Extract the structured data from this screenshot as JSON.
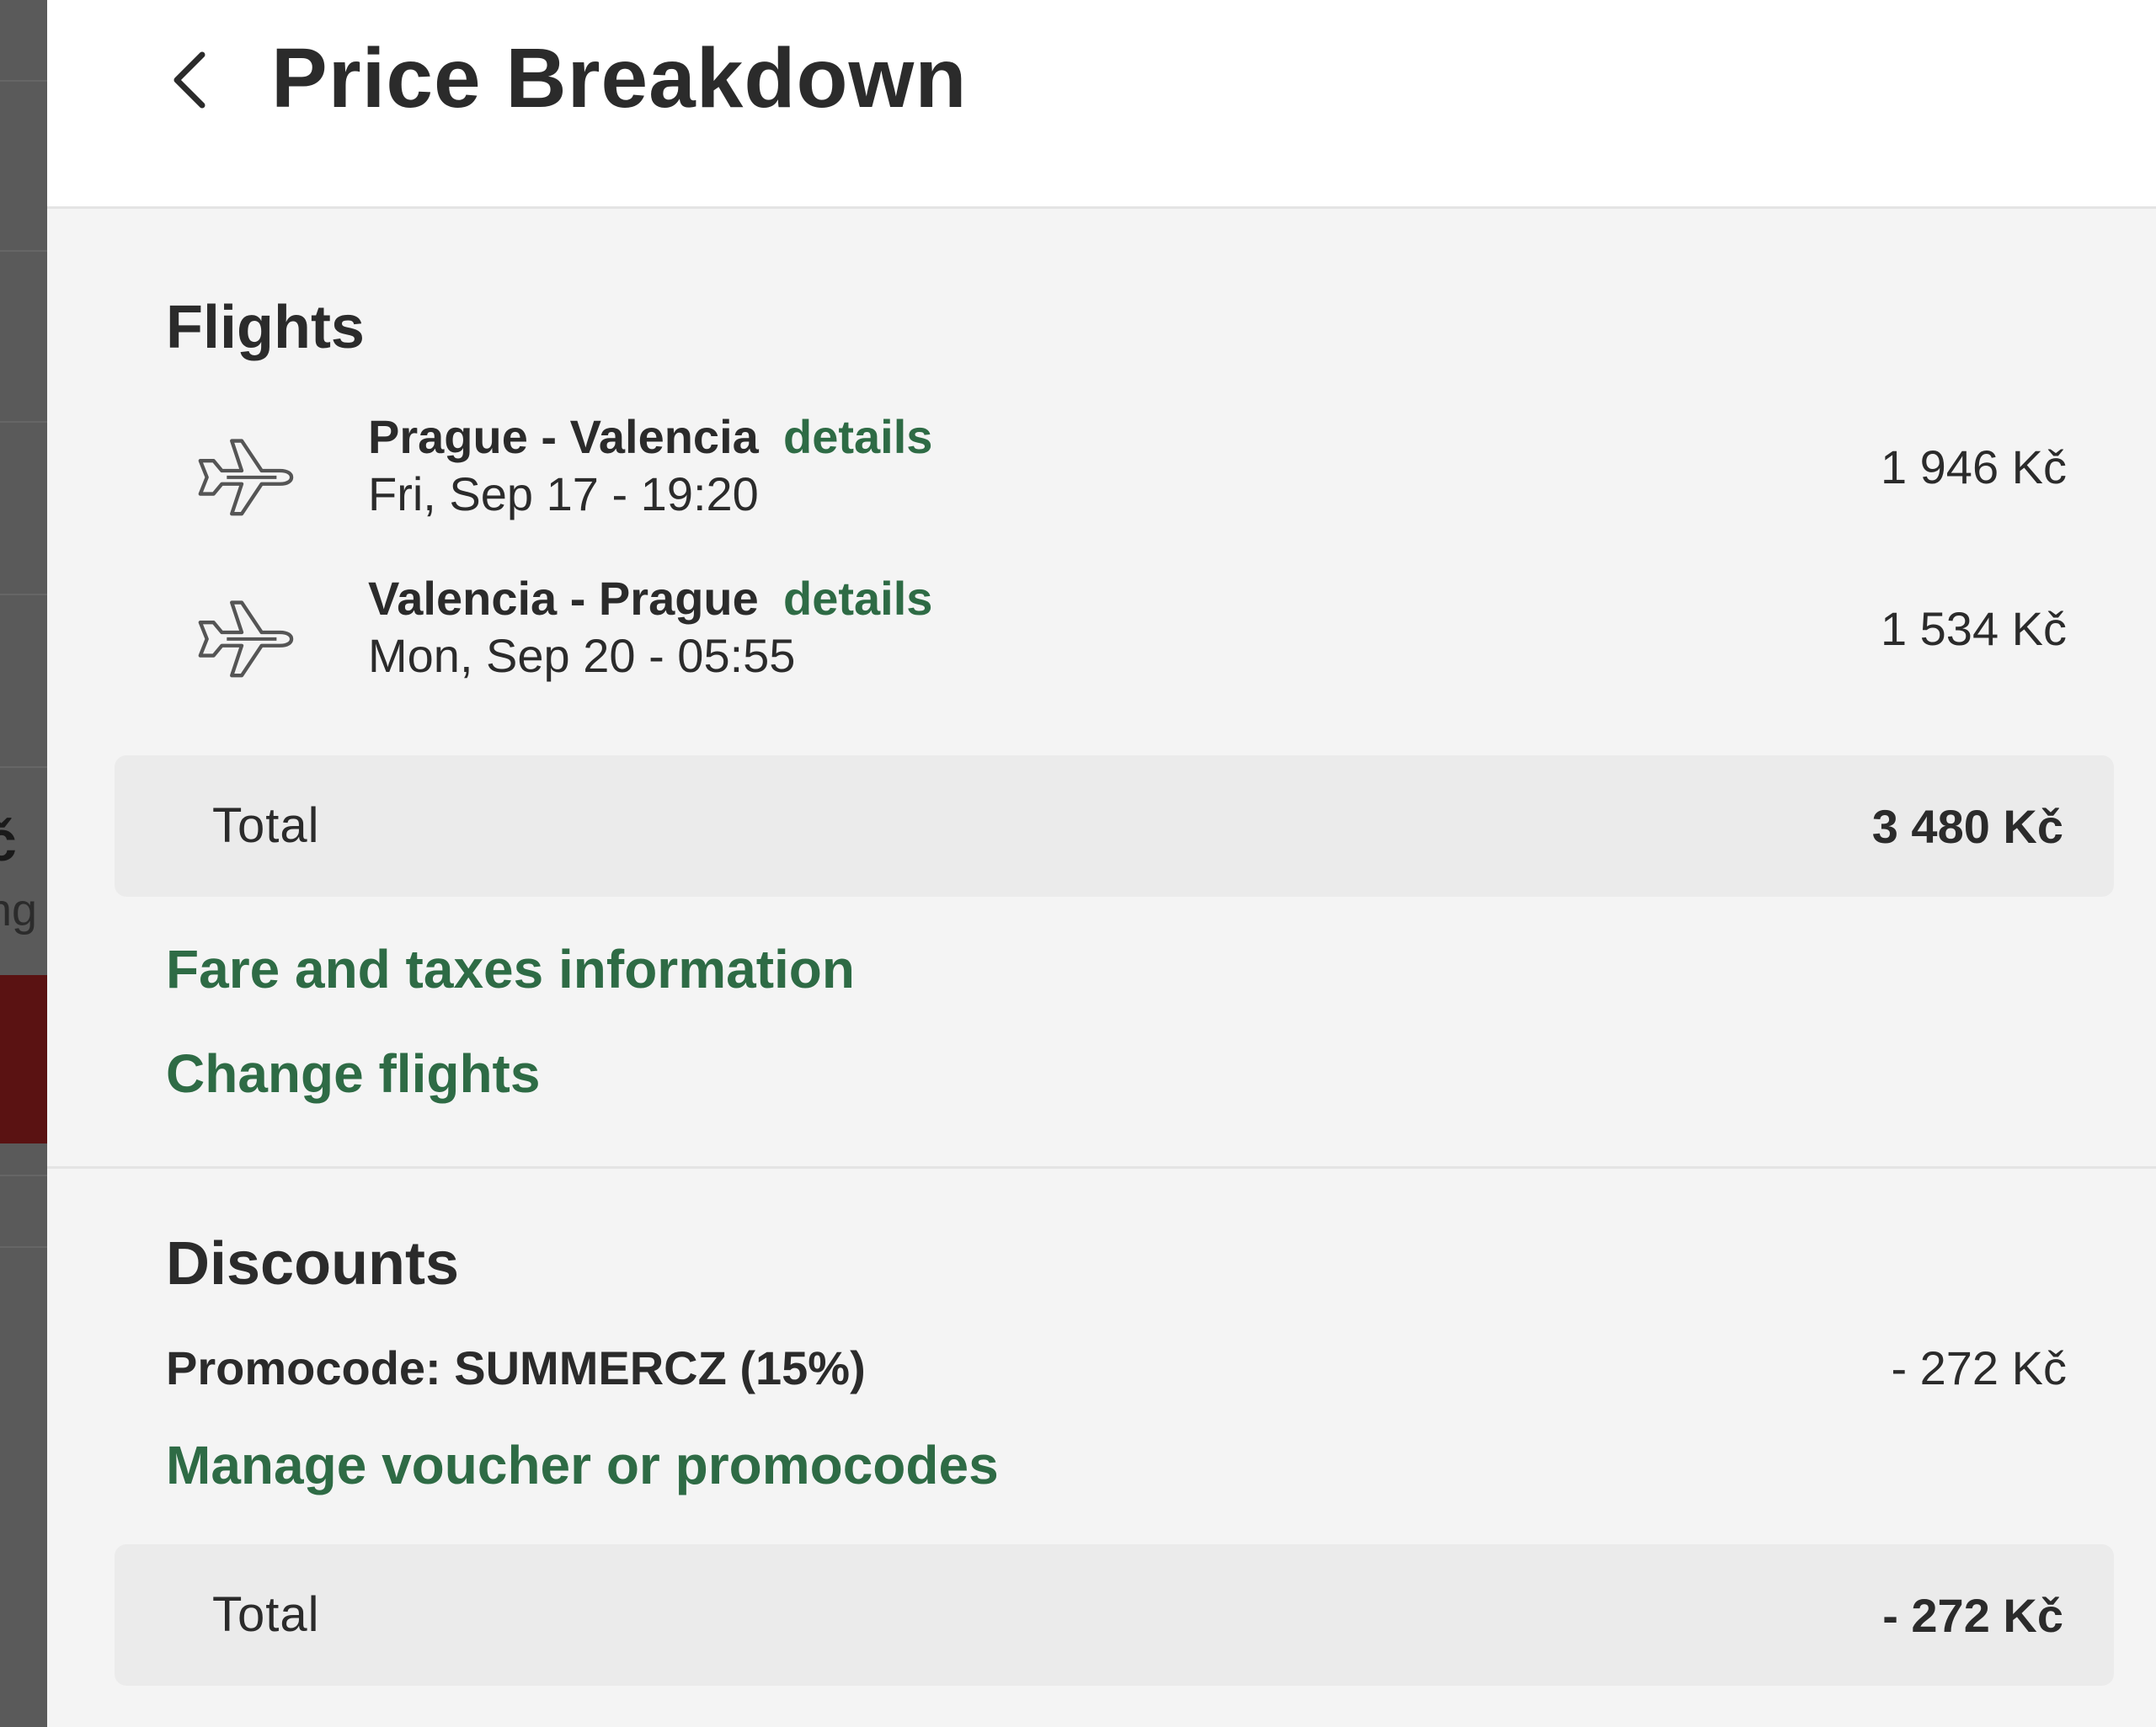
{
  "header": {
    "title": "Price Breakdown",
    "back_icon": "chevron-left-icon"
  },
  "flights": {
    "title": "Flights",
    "items": [
      {
        "icon": "plane-icon",
        "route": "Prague - Valencia",
        "details_label": "details",
        "date": "Fri, Sep 17 - 19:20",
        "price": "1 946 Kč"
      },
      {
        "icon": "plane-icon",
        "route": "Valencia - Prague",
        "details_label": "details",
        "date": "Mon, Sep 20 - 05:55",
        "price": "1 534 Kč"
      }
    ],
    "total_label": "Total",
    "total_value": "3 480 Kč",
    "fare_link": "Fare and taxes information",
    "change_link": "Change flights"
  },
  "discounts": {
    "title": "Discounts",
    "promo_label": "Promocode: SUMMERCZ (15%)",
    "promo_value": "- 272 Kč",
    "manage_link": "Manage voucher or promocodes",
    "total_label": "Total",
    "total_value": "- 272 Kč"
  },
  "background": {
    "price_fragment": "č",
    "sub_fragment": "ng"
  },
  "colors": {
    "accent_green": "#2e6b45",
    "text": "#2b2b2b",
    "panel_bg": "#f4f4f4",
    "total_bg": "#ebebeb"
  }
}
